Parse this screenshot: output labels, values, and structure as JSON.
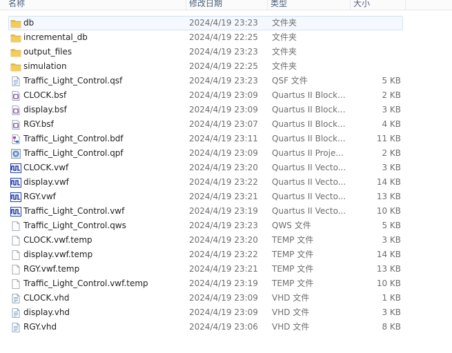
{
  "columns": {
    "name": "名称",
    "date": "修改日期",
    "type": "类型",
    "size": "大小"
  },
  "files": [
    {
      "name": "db",
      "date": "2024/4/19 23:23",
      "type": "文件夹",
      "size": "",
      "icon": "folder-icon",
      "selected": true
    },
    {
      "name": "incremental_db",
      "date": "2024/4/19 22:25",
      "type": "文件夹",
      "size": "",
      "icon": "folder-icon"
    },
    {
      "name": "output_files",
      "date": "2024/4/19 23:23",
      "type": "文件夹",
      "size": "",
      "icon": "folder-icon"
    },
    {
      "name": "simulation",
      "date": "2024/4/19 22:25",
      "type": "文件夹",
      "size": "",
      "icon": "folder-icon"
    },
    {
      "name": "Traffic_Light_Control.qsf",
      "date": "2024/4/19 23:23",
      "type": "QSF 文件",
      "size": "5 KB",
      "icon": "document-icon"
    },
    {
      "name": "CLOCK.bsf",
      "date": "2024/4/19 23:09",
      "type": "Quartus II Block...",
      "size": "2 KB",
      "icon": "block-symbol-icon"
    },
    {
      "name": "display.bsf",
      "date": "2024/4/19 23:09",
      "type": "Quartus II Block...",
      "size": "3 KB",
      "icon": "block-symbol-icon"
    },
    {
      "name": "RGY.bsf",
      "date": "2024/4/19 23:07",
      "type": "Quartus II Block...",
      "size": "4 KB",
      "icon": "block-symbol-icon"
    },
    {
      "name": "Traffic_Light_Control.bdf",
      "date": "2024/4/19 23:11",
      "type": "Quartus II Block...",
      "size": "11 KB",
      "icon": "block-diagram-icon"
    },
    {
      "name": "Traffic_Light_Control.qpf",
      "date": "2024/4/19 23:09",
      "type": "Quartus II Proje...",
      "size": "2 KB",
      "icon": "project-icon"
    },
    {
      "name": "CLOCK.vwf",
      "date": "2024/4/19 23:20",
      "type": "Quartus II Vecto...",
      "size": "3 KB",
      "icon": "waveform-icon"
    },
    {
      "name": "display.vwf",
      "date": "2024/4/19 23:22",
      "type": "Quartus II Vecto...",
      "size": "14 KB",
      "icon": "waveform-icon"
    },
    {
      "name": "RGY.vwf",
      "date": "2024/4/19 23:21",
      "type": "Quartus II Vecto...",
      "size": "13 KB",
      "icon": "waveform-icon"
    },
    {
      "name": "Traffic_Light_Control.vwf",
      "date": "2024/4/19 23:19",
      "type": "Quartus II Vecto...",
      "size": "10 KB",
      "icon": "waveform-icon"
    },
    {
      "name": "Traffic_Light_Control.qws",
      "date": "2024/4/19 23:23",
      "type": "QWS 文件",
      "size": "5 KB",
      "icon": "blank-file-icon"
    },
    {
      "name": "CLOCK.vwf.temp",
      "date": "2024/4/19 23:20",
      "type": "TEMP 文件",
      "size": "3 KB",
      "icon": "blank-file-icon"
    },
    {
      "name": "display.vwf.temp",
      "date": "2024/4/19 23:22",
      "type": "TEMP 文件",
      "size": "14 KB",
      "icon": "blank-file-icon"
    },
    {
      "name": "RGY.vwf.temp",
      "date": "2024/4/19 23:21",
      "type": "TEMP 文件",
      "size": "13 KB",
      "icon": "blank-file-icon"
    },
    {
      "name": "Traffic_Light_Control.vwf.temp",
      "date": "2024/4/19 23:19",
      "type": "TEMP 文件",
      "size": "10 KB",
      "icon": "blank-file-icon"
    },
    {
      "name": "CLOCK.vhd",
      "date": "2024/4/19 23:09",
      "type": "VHD 文件",
      "size": "1 KB",
      "icon": "document-icon"
    },
    {
      "name": "display.vhd",
      "date": "2024/4/19 23:09",
      "type": "VHD 文件",
      "size": "3 KB",
      "icon": "document-icon"
    },
    {
      "name": "RGY.vhd",
      "date": "2024/4/19 23:06",
      "type": "VHD 文件",
      "size": "8 KB",
      "icon": "document-icon"
    }
  ],
  "colors": {
    "folder": "#e8b840",
    "waveform": "#1b3aa8",
    "selection": "#cfe2f7"
  }
}
